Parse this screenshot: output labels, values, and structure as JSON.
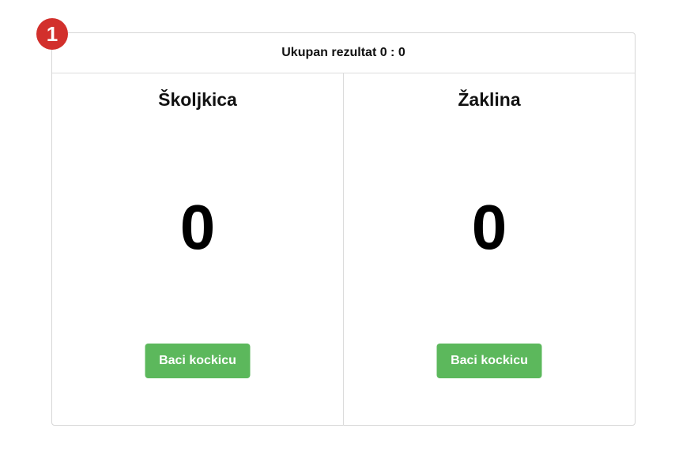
{
  "badge": {
    "number": "1",
    "color": "#d2302c"
  },
  "header": {
    "total_score_text": "Ukupan rezultat 0 : 0"
  },
  "players": [
    {
      "name": "Školjkica",
      "score": "0",
      "roll_button_label": "Baci kockicu"
    },
    {
      "name": "Žaklina",
      "score": "0",
      "roll_button_label": "Baci kockicu"
    }
  ],
  "colors": {
    "button": "#5cb85c",
    "border": "#d6d6d6"
  }
}
